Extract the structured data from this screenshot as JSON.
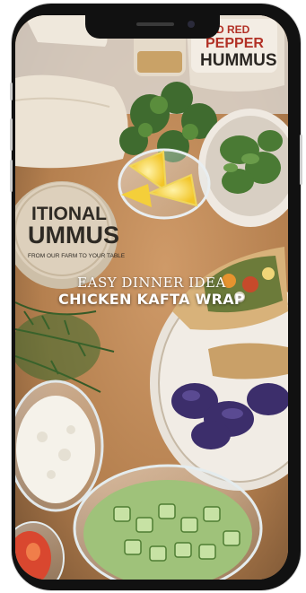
{
  "overlay": {
    "eyebrow": "EASY DINNER IDEA",
    "headline": "CHICKEN KAFTA WRAP"
  },
  "packaging": {
    "jar_top_right": [
      "ED RED",
      "PEPPER",
      "HUMMUS"
    ],
    "jar_left": [
      "ITIONAL",
      "UMMUS"
    ],
    "jar_left_tagline": "FROM OUR FARM TO YOUR TABLE"
  },
  "colors": {
    "board": "#b98a5c",
    "hummus_lid": "#ddd0bc",
    "herb_green": "#3f6b2f",
    "text_overlay": "#ffffff"
  }
}
